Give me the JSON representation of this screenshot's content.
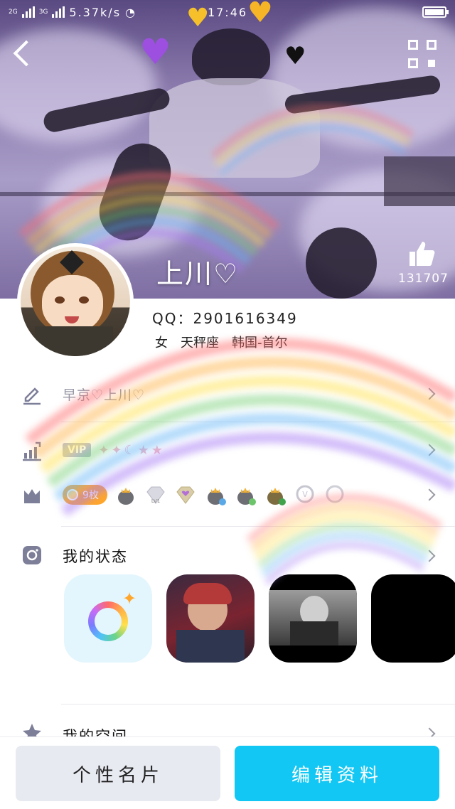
{
  "status_bar": {
    "network_1": "2G",
    "network_2": "3G",
    "speed": "5.37k/s",
    "time": "17:46"
  },
  "profile": {
    "name": "上川♡",
    "qq_label": "QQ：2901616349",
    "gender": "女",
    "zodiac": "天秤座",
    "location": "韩国-首尔",
    "likes": "131707"
  },
  "rows": {
    "signature": "早京♡上川♡",
    "vip_label": "VIP",
    "level_icons": [
      "✦",
      "✦",
      "☾",
      "★",
      "★"
    ],
    "medal_count": "9枚",
    "medals": [
      "crown-penguin",
      "diamond-lv1",
      "diamond-heart",
      "crown-penguin-star",
      "crown-penguin-heart",
      "crown-penguin-leaf",
      "v-badge-lv1",
      "v-badge-lv1-b"
    ],
    "status_title": "我的状态",
    "space_title": "我的空间"
  },
  "buttons": {
    "card": "个性名片",
    "edit": "编辑资料"
  },
  "colors": {
    "accent": "#12c7f4",
    "medal_pill": "#ffa62b",
    "vip_badge": "#b9bbd2"
  },
  "icons": [
    "back-arrow-icon",
    "qr-code-icon",
    "thumbs-up-icon",
    "pencil-icon",
    "level-chart-icon",
    "medal-box-icon",
    "camera-icon",
    "star-space-icon"
  ]
}
